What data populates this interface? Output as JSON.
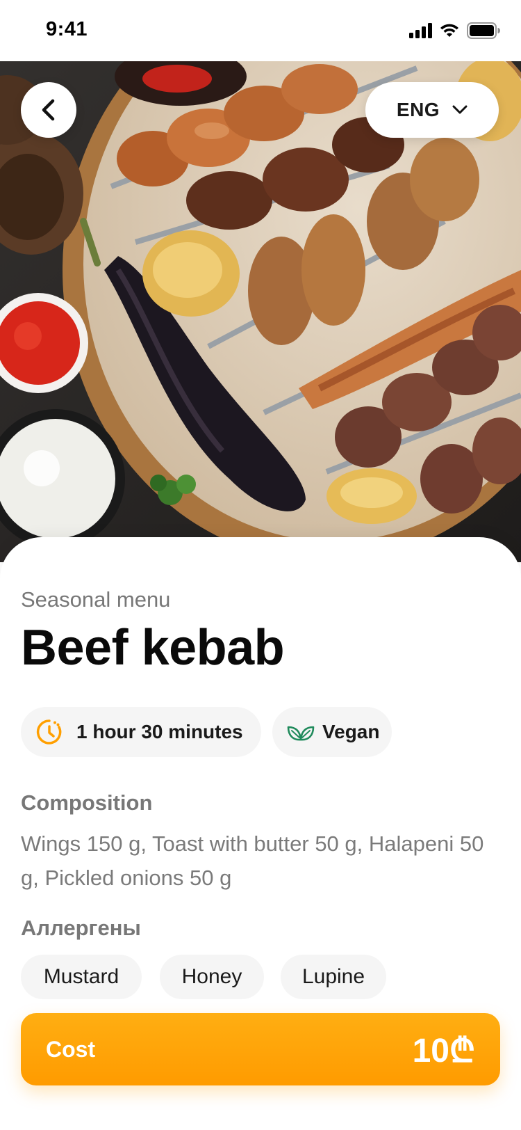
{
  "status_bar": {
    "time": "9:41"
  },
  "header": {
    "language": "ENG"
  },
  "dish": {
    "category": "Seasonal menu",
    "name": "Beef kebab",
    "cook_time": "1 hour 30 minutes",
    "diet_tag": "Vegan"
  },
  "composition": {
    "title": "Composition",
    "text": "Wings 150 g, Toast with butter 50 g, Halapeni 50 g, Pickled onions 50 g"
  },
  "allergens": {
    "title": "Аллергены",
    "items": [
      "Mustard",
      "Honey",
      "Lupine"
    ]
  },
  "cost": {
    "label": "Cost",
    "price": "10₾"
  },
  "colors": {
    "accent": "#FF9F00",
    "vegan_icon": "#1F8A5B",
    "time_icon": "#FF9F00"
  },
  "icons": [
    "back-arrow-icon",
    "chevron-down-icon",
    "clock-icon",
    "leaf-icon",
    "signal-icon",
    "wifi-icon",
    "battery-icon"
  ]
}
